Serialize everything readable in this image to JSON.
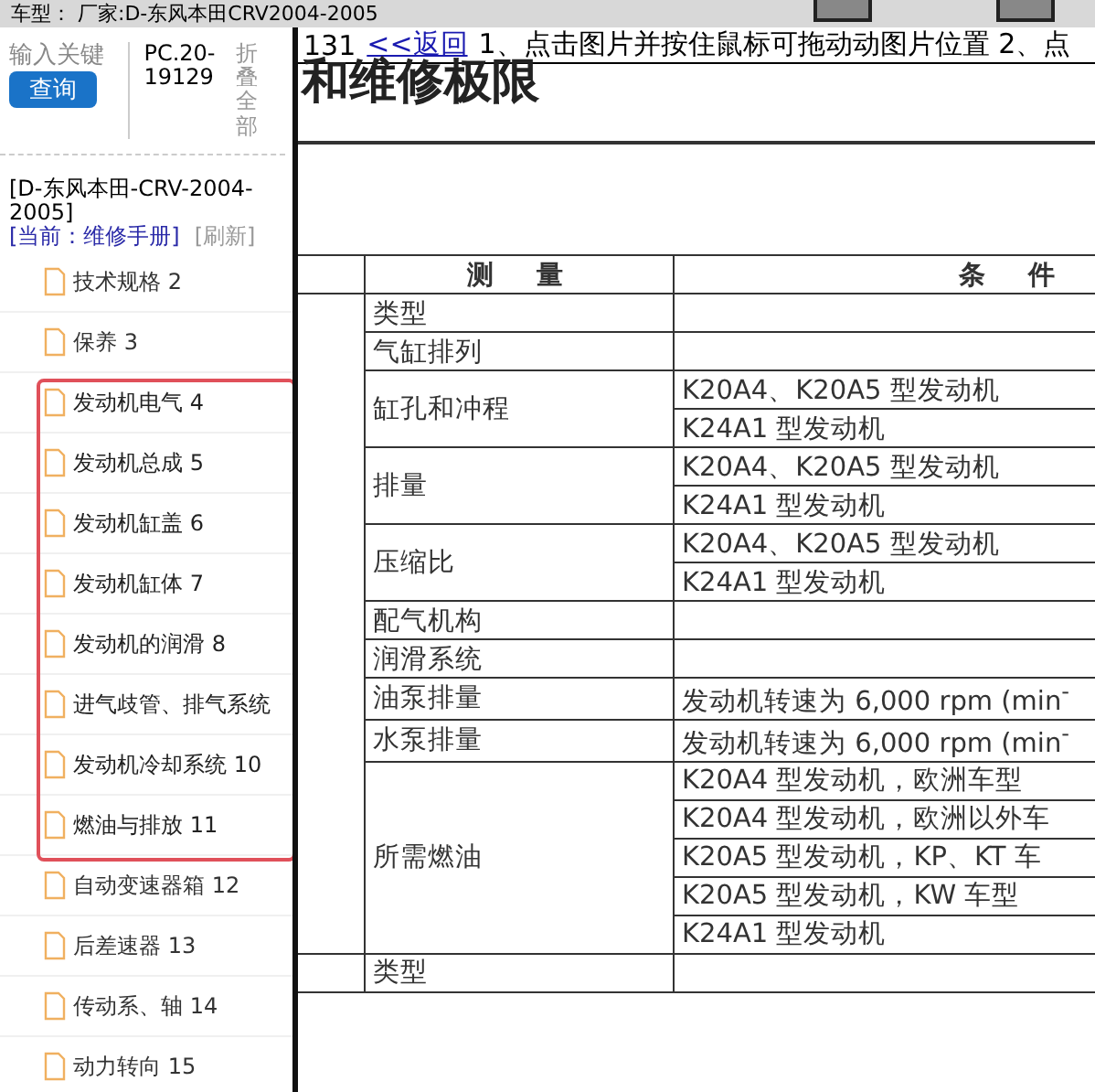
{
  "top_bar": {
    "title": "车型： 厂家:D-东风本田CRV2004-2005"
  },
  "sidebar": {
    "search": {
      "placeholder": "输入关键"
    },
    "search_button": "查询",
    "code": "PC.20-19129",
    "collapse": "折叠全部",
    "model": "[D-东风本田-CRV-2004-2005]",
    "current": "[当前：维修手册]",
    "refresh": "[刷新]",
    "items": [
      {
        "label": "技术规格 2",
        "highlighted": false
      },
      {
        "label": "保养 3",
        "highlighted": false
      },
      {
        "label": "发动机电气 4",
        "highlighted": true
      },
      {
        "label": "发动机总成 5",
        "highlighted": true
      },
      {
        "label": "发动机缸盖 6",
        "highlighted": true
      },
      {
        "label": "发动机缸体 7",
        "highlighted": true
      },
      {
        "label": "发动机的润滑 8",
        "highlighted": true
      },
      {
        "label": "进气歧管、排气系统",
        "highlighted": true
      },
      {
        "label": "发动机冷却系统 10",
        "highlighted": true
      },
      {
        "label": "燃油与排放 11",
        "highlighted": true
      },
      {
        "label": "自动变速器箱 12",
        "highlighted": false
      },
      {
        "label": "后差速器 13",
        "highlighted": false
      },
      {
        "label": "传动系、轴 14",
        "highlighted": false
      },
      {
        "label": "动力转向 15",
        "highlighted": false
      }
    ]
  },
  "viewer": {
    "page": "131",
    "back_link": "<<返回",
    "hint": "1、点击图片并按住鼠标可拖动动图片位置 2、点",
    "heading": "和维修极限",
    "table": {
      "columns": [
        "测　量",
        "条　件"
      ],
      "sections": [
        {
          "rows": [
            {
              "measure": "类型",
              "conditions": []
            },
            {
              "measure": "气缸排列",
              "conditions": []
            },
            {
              "measure": "缸孔和冲程",
              "conditions": [
                "K20A4、K20A5 型发动机",
                "K24A1 型发动机"
              ]
            },
            {
              "measure": "排量",
              "conditions": [
                "K20A4、K20A5 型发动机",
                "K24A1 型发动机"
              ]
            },
            {
              "measure": "压缩比",
              "conditions": [
                "K20A4、K20A5 型发动机",
                "K24A1 型发动机"
              ]
            },
            {
              "measure": "配气机构",
              "conditions": []
            },
            {
              "measure": "润滑系统",
              "conditions": []
            },
            {
              "measure": "油泵排量",
              "conditions": [
                "发动机转速为 6,000 rpm (min$^{-}$"
              ]
            },
            {
              "measure": "水泵排量",
              "conditions": [
                "发动机转速为 6,000 rpm (min$^{-}$"
              ]
            },
            {
              "measure": "所需燃油",
              "conditions": [
                "K20A4 型发动机，欧洲车型",
                "K20A4 型发动机，欧洲以外车",
                "K20A5 型发动机，KP、KT 车",
                "K20A5 型发动机，KW 车型",
                "K24A1 型发动机"
              ]
            }
          ]
        },
        {
          "rows": [
            {
              "measure": "类型",
              "conditions": []
            }
          ]
        }
      ]
    }
  }
}
